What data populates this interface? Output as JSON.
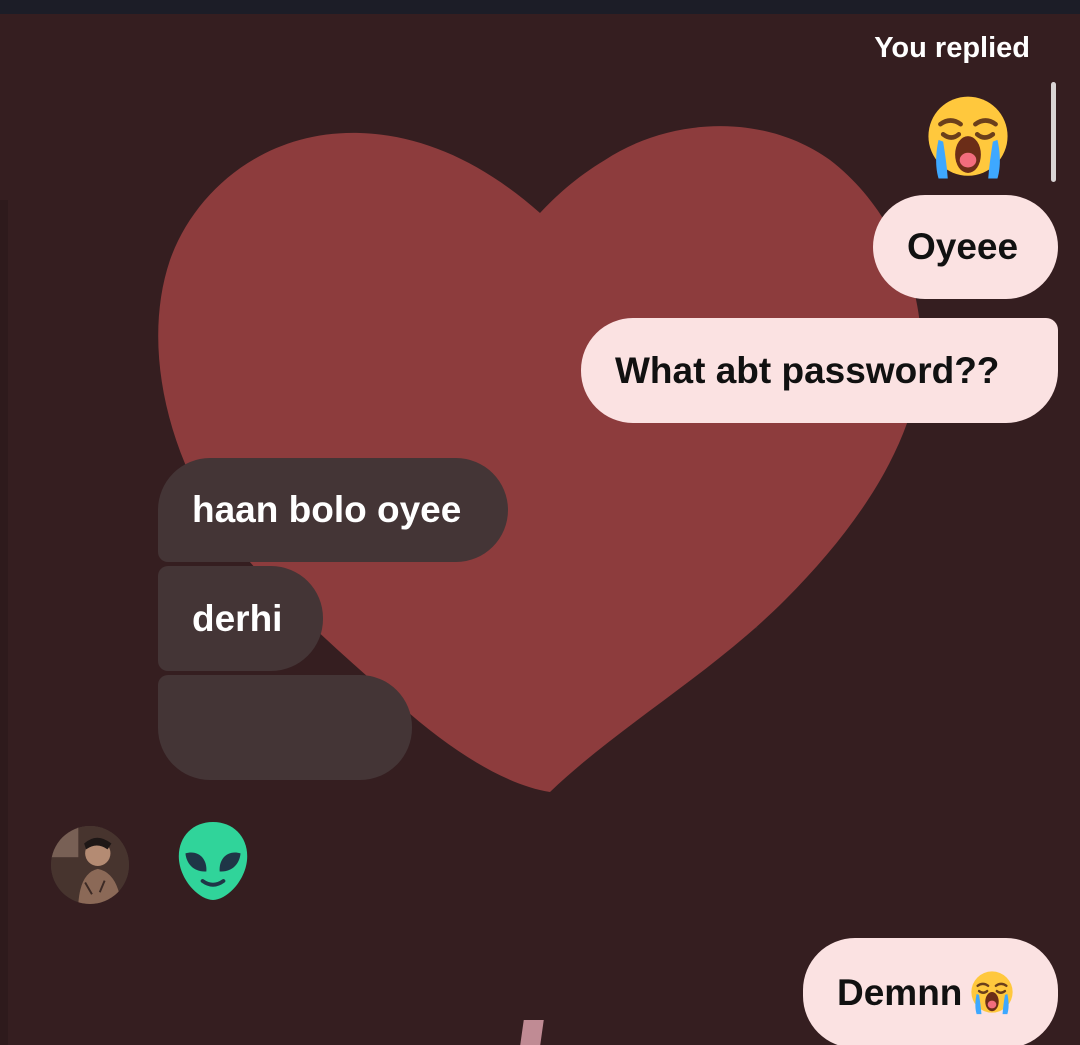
{
  "chat": {
    "reply_label": "You replied",
    "reaction_icon": "crying-face-icon",
    "messages": [
      {
        "direction": "outgoing",
        "text": "Oyeee"
      },
      {
        "direction": "outgoing",
        "text": "What abt password??"
      },
      {
        "direction": "incoming",
        "text": "haan bolo oyee"
      },
      {
        "direction": "incoming",
        "text": "derhi"
      },
      {
        "direction": "incoming",
        "text": ""
      },
      {
        "direction": "incoming",
        "emoji": "alien-face-icon"
      },
      {
        "direction": "outgoing",
        "text": "Demnn",
        "emoji": "crying-face-icon"
      }
    ]
  },
  "theme": {
    "background": "#351e20",
    "heart": "#8d3c3d",
    "outgoing_bubble": "#fbe2e2",
    "incoming_bubble": "#443536"
  }
}
